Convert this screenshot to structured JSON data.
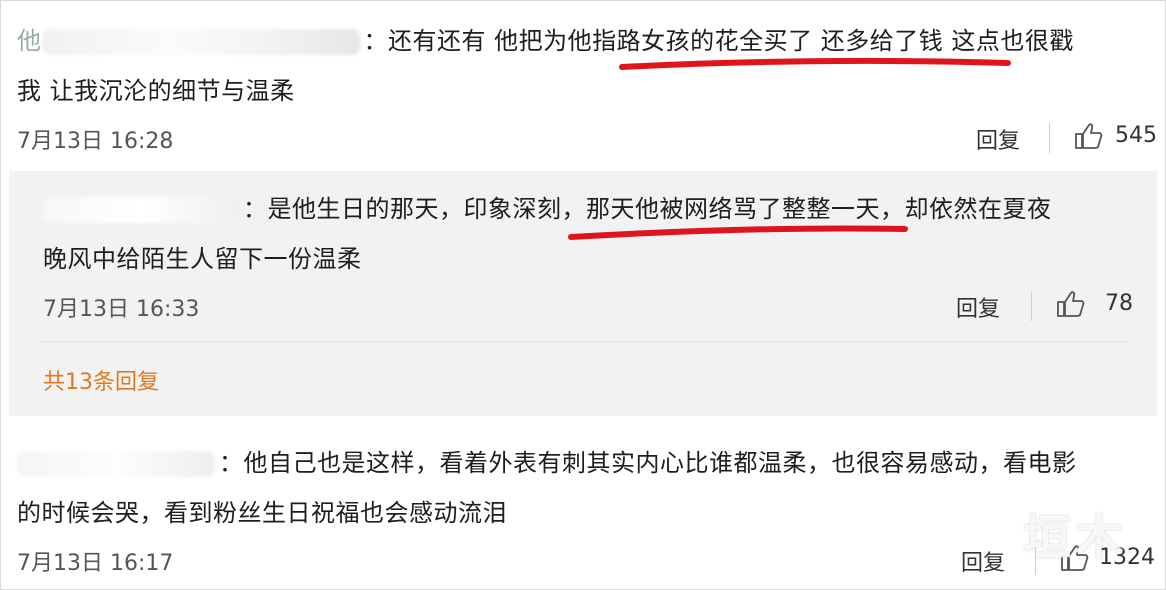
{
  "comments": [
    {
      "name_masked": "他",
      "text_line1": "：还有还有 他把为他指路女孩的花全买了 还多给了钱 这点也很戳",
      "text_line2": "我 让我沉沦的细节与温柔",
      "time": "7月13日 16:28",
      "reply_label": "回复",
      "like_count": "545"
    },
    {
      "text_line1": "：是他生日的那天，印象深刻，那天他被网络骂了整整一天，却依然在夏夜",
      "text_line2": "晚风中给陌生人留下一份温柔",
      "time": "7月13日 16:33",
      "reply_label": "回复",
      "like_count": "78"
    },
    {
      "text_line1": "：他自己也是这样，看着外表有刺其实内心比谁都温柔，也很容易感动，看电影",
      "text_line2": "的时候会哭，看到粉丝生日祝福也会感动流泪",
      "time": "7月13日 16:17",
      "reply_label": "回复",
      "like_count": "1324"
    }
  ],
  "more_replies": "共13条回复",
  "watermark": "垣木",
  "colors": {
    "accent": "#e07a20",
    "underline": "#e0151b"
  }
}
